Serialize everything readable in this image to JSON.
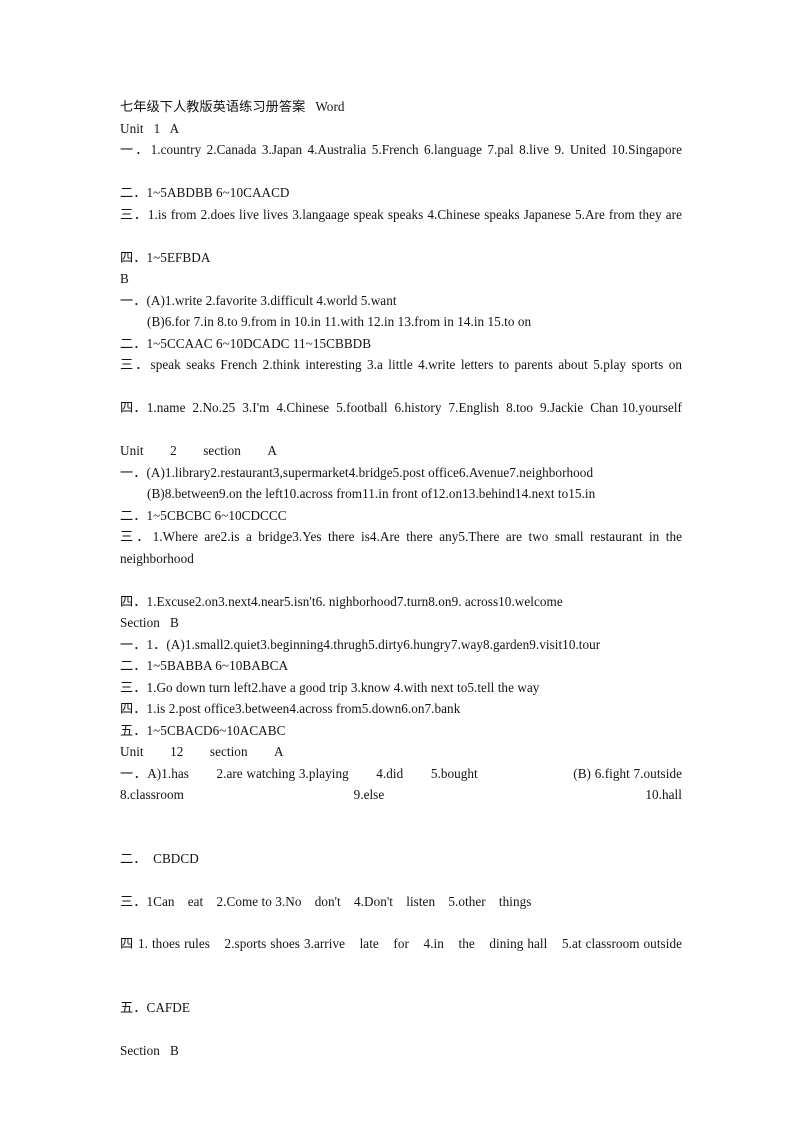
{
  "document": {
    "title": "七年级下人教版英语练习册答案　Word",
    "page_background": "#ffffff",
    "text_color": "#131313"
  },
  "blocks": [
    {
      "id": "doc-title",
      "style": "plain",
      "text": "七年级下人教版英语练习册答案   Word"
    },
    {
      "id": "unit1-heading",
      "style": "plain",
      "text": "Unit   1   A"
    },
    {
      "id": "unit1-a-q1",
      "style": "justify",
      "text": "一．1.country 2.Canada 3.Japan 4.Australia 5.French 6.language 7.pal 8.live 9. United 10.Singapore"
    },
    {
      "id": "unit1-a-q2",
      "style": "plain",
      "text": "二．1~5ABDBB 6~10CAACD"
    },
    {
      "id": "unit1-a-q3",
      "style": "justify",
      "text": "三．1.is from 2.does live lives 3.langaage speak speaks 4.Chinese speaks Japanese 5.Are from they are"
    },
    {
      "id": "unit1-a-q4",
      "style": "plain",
      "text": "四．1~5EFBDA"
    },
    {
      "id": "unit1-b-heading",
      "style": "plain",
      "text": "B"
    },
    {
      "id": "unit1-b-q1a",
      "style": "plain",
      "text": "一．(A)1.write 2.favorite 3.difficult 4.world 5.want"
    },
    {
      "id": "unit1-b-q1b",
      "style": "indent",
      "text": "(B)6.for 7.in 8.to 9.from in 10.in 11.with 12.in 13.from in 14.in 15.to on"
    },
    {
      "id": "unit1-b-q2",
      "style": "plain",
      "text": "二．1~5CCAAC 6~10DCADC 11~15CBBDB"
    },
    {
      "id": "unit1-b-q3",
      "style": "justify",
      "text": "三．speak seaks French 2.think interesting 3.a little 4.write letters to parents about 5.play sports on"
    },
    {
      "id": "unit1-b-q4",
      "style": "justify",
      "text": "四．1.name  2.No.25  3.I'm  4.Chinese  5.football  6.history  7.English  8.too  9.Jackie  Chan 10.yourself"
    },
    {
      "id": "unit2-a-heading",
      "style": "plain",
      "text": "Unit　　2　　section　　A"
    },
    {
      "id": "unit2-a-q1a",
      "style": "plain",
      "text": "一．(A)1.library2.restaurant3,supermarket4.bridge5.post office6.Avenue7.neighborhood"
    },
    {
      "id": "unit2-a-q1b",
      "style": "indent",
      "text": "(B)8.between9.on the left10.across from11.in front of12.on13.behind14.next to15.in"
    },
    {
      "id": "unit2-a-q2",
      "style": "plain",
      "text": "二．1~5CBCBC 6~10CDCCC"
    },
    {
      "id": "unit2-a-q3",
      "style": "justify",
      "text": "三．1.Where are2.is a bridge3.Yes there is4.Are there any5.There are two small restaurant in the neighborhood"
    },
    {
      "id": "unit2-a-q4",
      "style": "plain",
      "text": "四．1.Excuse2.on3.next4.near5.isn't6. nighborhood7.turn8.on9. across10.welcome"
    },
    {
      "id": "unit2-b-heading",
      "style": "plain",
      "text": "Section   B"
    },
    {
      "id": "unit2-b-q1",
      "style": "plain",
      "text": "一．1．(A)1.small2.quiet3.beginning4.thrugh5.dirty6.hungry7.way8.garden9.visit10.tour"
    },
    {
      "id": "unit2-b-q2",
      "style": "plain",
      "text": "二．1~5BABBA 6~10BABCA"
    },
    {
      "id": "unit2-b-q3",
      "style": "plain",
      "text": "三．1.Go down turn left2.have a good trip 3.know 4.with next to5.tell the way"
    },
    {
      "id": "unit2-b-q4",
      "style": "plain",
      "text": "四．1.is 2.post office3.between4.across from5.down6.on7.bank"
    },
    {
      "id": "unit2-b-q5",
      "style": "plain",
      "text": "五．1~5CBACD6~10ACABC"
    },
    {
      "id": "unit12-a-heading",
      "style": "plain",
      "text": "Unit　　12　　section　　A"
    },
    {
      "id": "unit12-a-q1",
      "style": "justify",
      "text": "一．A)1.has　　2.are watching 3.playing　　4.did　　5.bought　　　　　　　(B) 6.fight 7.outside 8.classroom　9.else　　10.hall"
    },
    {
      "id": "unit12-gap-1",
      "style": "gap-md",
      "text": ""
    },
    {
      "id": "unit12-a-q2",
      "style": "plain",
      "text": "二．　CBDCD"
    },
    {
      "id": "unit12-gap-2",
      "style": "gap-md",
      "text": ""
    },
    {
      "id": "unit12-a-q3",
      "style": "plain",
      "text": "三．1Can　eat　2.Come to 3.No　don't　4.Don't　listen　5.other　things"
    },
    {
      "id": "unit12-gap-3",
      "style": "gap-md",
      "text": ""
    },
    {
      "id": "unit12-a-q4",
      "style": "justify",
      "text": "四 1. thoes rules　2.sports shoes 3.arrive　late　for　4.in　the　dining hall　5.at classroom outside"
    },
    {
      "id": "unit12-gap-4",
      "style": "gap-md",
      "text": ""
    },
    {
      "id": "unit12-a-q5",
      "style": "plain",
      "text": "五．CAFDE"
    },
    {
      "id": "unit12-gap-5",
      "style": "gap-md",
      "text": ""
    },
    {
      "id": "unit12-b-heading",
      "style": "plain",
      "text": "Section   B"
    }
  ]
}
